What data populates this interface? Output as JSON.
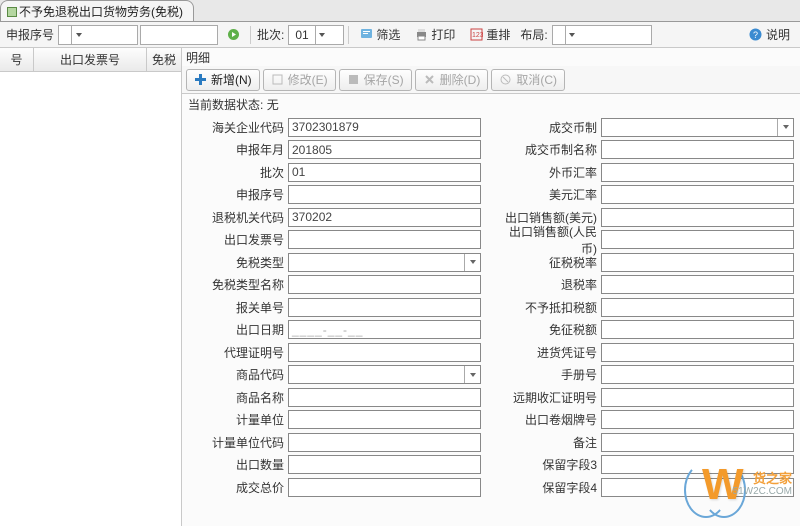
{
  "tab": {
    "title": "不予免退税出口货物劳务(免税)"
  },
  "toolbar": {
    "seq_label": "申报序号",
    "seq_value": "",
    "forward_icon": "go-icon",
    "batch_label": "批次:",
    "batch_value": "01",
    "filter": "筛选",
    "print": "打印",
    "rearrange": "重排",
    "layout_label": "布局:",
    "help": "说明"
  },
  "leftpanel": {
    "col1": "号",
    "col2": "出口发票号",
    "col3": "免税"
  },
  "section_title": "明细",
  "buttons": {
    "add": "新增(N)",
    "edit": "修改(E)",
    "save": "保存(S)",
    "delete": "删除(D)",
    "cancel": "取消(C)"
  },
  "status": {
    "label": "当前数据状态:",
    "value": "无"
  },
  "left_fields": {
    "customs_code": {
      "label": "海关企业代码",
      "value": "3702301879",
      "type": "text"
    },
    "report_ym": {
      "label": "申报年月",
      "value": "201805",
      "type": "text"
    },
    "batch": {
      "label": "批次",
      "value": "01",
      "type": "text"
    },
    "seq": {
      "label": "申报序号",
      "value": "",
      "type": "text"
    },
    "refund_org": {
      "label": "退税机关代码",
      "value": "370202",
      "type": "text"
    },
    "export_invoice": {
      "label": "出口发票号",
      "value": "",
      "type": "text"
    },
    "exempt_type": {
      "label": "免税类型",
      "value": "",
      "type": "combo"
    },
    "exempt_name": {
      "label": "免税类型名称",
      "value": "",
      "type": "text"
    },
    "decl_no": {
      "label": "报关单号",
      "value": "",
      "type": "text"
    },
    "export_date": {
      "label": "出口日期",
      "value": "____-__-__",
      "type": "date"
    },
    "agent_no": {
      "label": "代理证明号",
      "value": "",
      "type": "text"
    },
    "goods_code": {
      "label": "商品代码",
      "value": "",
      "type": "combo"
    },
    "goods_name": {
      "label": "商品名称",
      "value": "",
      "type": "text"
    },
    "unit": {
      "label": "计量单位",
      "value": "",
      "type": "text"
    },
    "unit_code": {
      "label": "计量单位代码",
      "value": "",
      "type": "text"
    },
    "export_qty": {
      "label": "出口数量",
      "value": "",
      "type": "text"
    },
    "total_price": {
      "label": "成交总价",
      "value": "",
      "type": "text"
    }
  },
  "right_fields": {
    "currency": {
      "label": "成交币制",
      "value": "",
      "type": "combo"
    },
    "currency_name": {
      "label": "成交币制名称",
      "value": "",
      "type": "text"
    },
    "fx_rate": {
      "label": "外币汇率",
      "value": "",
      "type": "text"
    },
    "usd_rate": {
      "label": "美元汇率",
      "value": "",
      "type": "text"
    },
    "sales_usd": {
      "label": "出口销售额(美元)",
      "value": "",
      "type": "text"
    },
    "sales_rmb": {
      "label": "出口销售额(人民币)",
      "value": "",
      "type": "text"
    },
    "tax_rate": {
      "label": "征税税率",
      "value": "",
      "type": "text"
    },
    "refund_rate": {
      "label": "退税率",
      "value": "",
      "type": "text"
    },
    "nodeduct": {
      "label": "不予抵扣税额",
      "value": "",
      "type": "text"
    },
    "exempt_amount": {
      "label": "免征税额",
      "value": "",
      "type": "text"
    },
    "purchase_cert": {
      "label": "进货凭证号",
      "value": "",
      "type": "text"
    },
    "manual_no": {
      "label": "手册号",
      "value": "",
      "type": "text"
    },
    "forward_cert": {
      "label": "远期收汇证明号",
      "value": "",
      "type": "text"
    },
    "cig_brand": {
      "label": "出口卷烟牌号",
      "value": "",
      "type": "text"
    },
    "remark": {
      "label": "备注",
      "value": "",
      "type": "text"
    },
    "reserve3": {
      "label": "保留字段3",
      "value": "",
      "type": "text"
    },
    "reserve4": {
      "label": "保留字段4",
      "value": "",
      "type": "text"
    }
  },
  "watermark": {
    "brand": "货之家",
    "domain": "51W2C.COM"
  }
}
